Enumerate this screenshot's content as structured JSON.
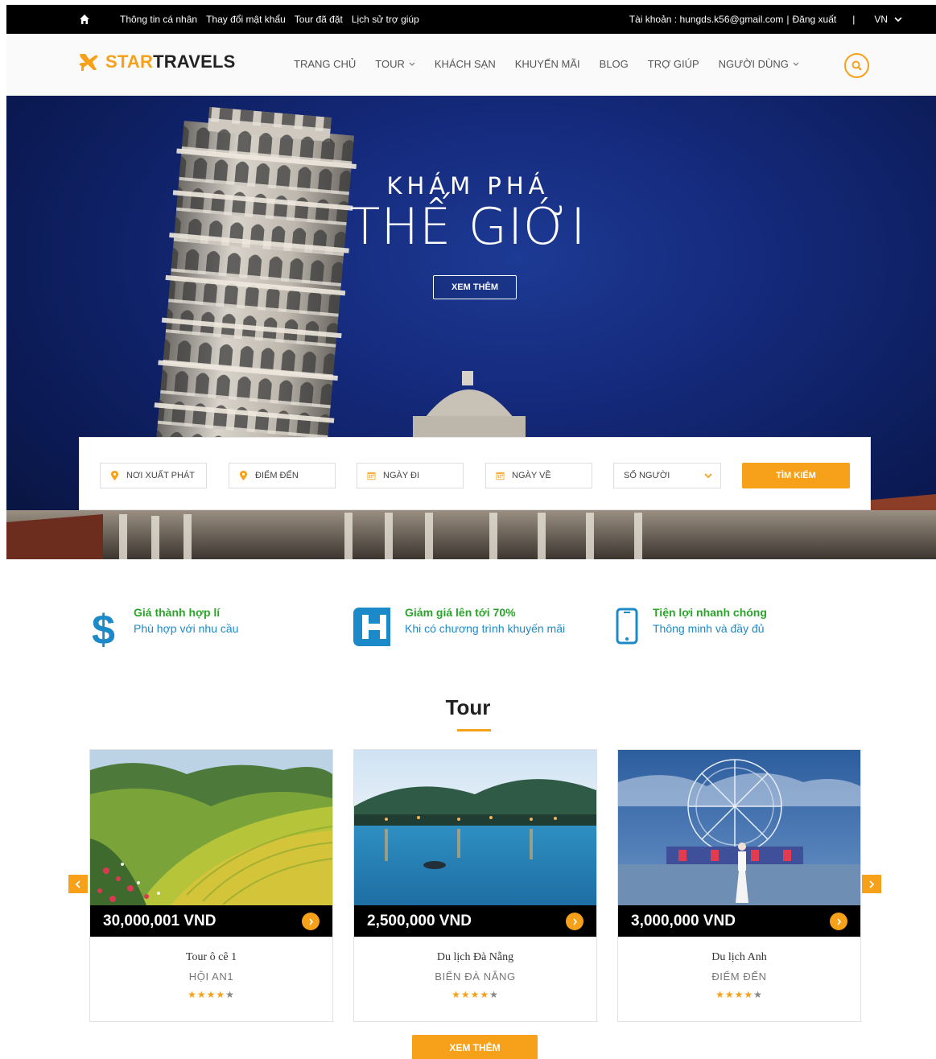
{
  "topbar": {
    "links": [
      "Thông tin cá nhân",
      "Thay đổi mật khẩu",
      "Tour đã đặt",
      "Lịch sử trợ giúp"
    ],
    "account_label": "Tài khoản : hungds.k56@gmail.com",
    "separator": "|",
    "logout": "Đăng xuất",
    "divider": "|",
    "language": "VN"
  },
  "brand": {
    "star": "STAR",
    "travels": "TRAVELS",
    "accent": "#f7a11a"
  },
  "nav": {
    "home": "TRANG CHỦ",
    "tour": "TOUR",
    "hotel": "KHÁCH SẠN",
    "promo": "KHUYẾN MÃI",
    "blog": "BLOG",
    "help": "TRỢ GIÚP",
    "user": "NGƯỜI DÙNG"
  },
  "hero": {
    "kicker": "KHÁM PHÁ",
    "title": "THẾ GIỚI",
    "button": "XEM THÊM"
  },
  "search": {
    "from_placeholder": "NƠI XUẤT PHÁT",
    "to_placeholder": "ĐIỂM ĐẾN",
    "depart_placeholder": "NGÀY ĐI",
    "return_placeholder": "NGÀY VỀ",
    "people_selected": "SỐ NGƯỜI",
    "submit": "TÌM KIẾM"
  },
  "features": [
    {
      "icon": "dollar-icon",
      "title": "Giá thành hợp lí",
      "text": "Phù hợp với nhu cầu"
    },
    {
      "icon": "hotel-h-icon",
      "title": "Giảm giá lên tới 70%",
      "text": "Khi có chương trình khuyến mãi"
    },
    {
      "icon": "mobile-icon",
      "title": "Tiện lợi nhanh chóng",
      "text": "Thông minh và đầy đủ"
    }
  ],
  "tours_section": {
    "title": "Tour",
    "cards": [
      {
        "price": "30,000,001 VND",
        "name": "Tour ô cê 1",
        "place": "HỘI AN1",
        "rating": 4,
        "photo": "rice-terraces-photo"
      },
      {
        "price": "2,500,000 VND",
        "name": "Du lịch Đà Nẵng",
        "place": "BIỂN ĐÀ NẴNG",
        "rating": 4,
        "photo": "bay-at-dusk-photo"
      },
      {
        "price": "3,000,000 VND",
        "name": "Du lịch Anh",
        "place": "ĐIỂM ĐẾN",
        "rating": 4,
        "photo": "ferris-wheel-photo"
      }
    ],
    "more_button": "XEM THÊM"
  }
}
